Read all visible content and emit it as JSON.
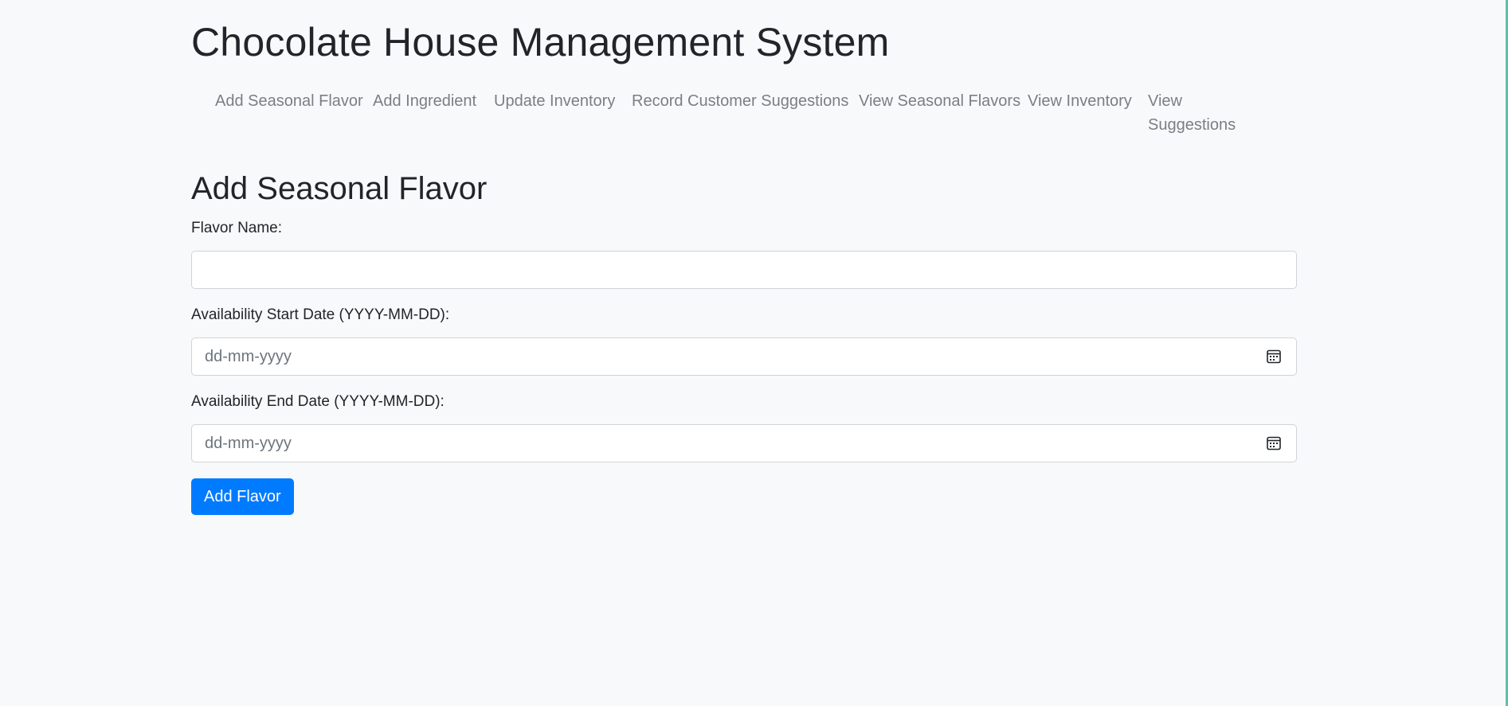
{
  "header": {
    "title": "Chocolate House Management System"
  },
  "nav": {
    "items": [
      {
        "label": "Add Seasonal Flavor"
      },
      {
        "label": "Add Ingredient"
      },
      {
        "label": "Update Inventory"
      },
      {
        "label": "Record Customer Suggestions"
      },
      {
        "label": "View Seasonal Flavors"
      },
      {
        "label": "View Inventory"
      },
      {
        "label": "View Suggestions"
      }
    ]
  },
  "form": {
    "title": "Add Seasonal Flavor",
    "flavor_name": {
      "label": "Flavor Name:",
      "value": "",
      "placeholder": ""
    },
    "start_date": {
      "label": "Availability Start Date (YYYY-MM-DD):",
      "placeholder": "dd-mm-yyyy",
      "icon": "calendar-icon"
    },
    "end_date": {
      "label": "Availability End Date (YYYY-MM-DD):",
      "placeholder": "dd-mm-yyyy",
      "icon": "calendar-icon"
    },
    "submit_label": "Add Flavor"
  },
  "colors": {
    "background": "#f8f9fa",
    "primary": "#007bff",
    "nav_link": "#7a7f84",
    "edge_accent": "#5fbfae"
  }
}
